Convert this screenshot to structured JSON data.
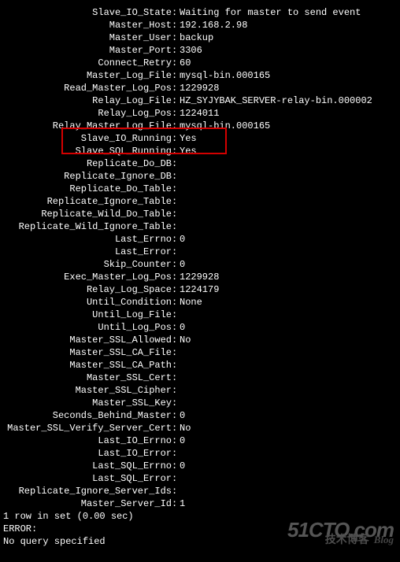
{
  "status": {
    "rows": [
      {
        "label": "Slave_IO_State",
        "value": "Waiting for master to send event"
      },
      {
        "label": "Master_Host",
        "value": "192.168.2.98"
      },
      {
        "label": "Master_User",
        "value": "backup"
      },
      {
        "label": "Master_Port",
        "value": "3306"
      },
      {
        "label": "Connect_Retry",
        "value": "60"
      },
      {
        "label": "Master_Log_File",
        "value": "mysql-bin.000165"
      },
      {
        "label": "Read_Master_Log_Pos",
        "value": "1229928"
      },
      {
        "label": "Relay_Log_File",
        "value": "HZ_SYJYBAK_SERVER-relay-bin.000002"
      },
      {
        "label": "Relay_Log_Pos",
        "value": "1224011"
      },
      {
        "label": "Relay_Master_Log_File",
        "value": "mysql-bin.000165"
      },
      {
        "label": "Slave_IO_Running",
        "value": "Yes"
      },
      {
        "label": "Slave_SQL_Running",
        "value": "Yes"
      },
      {
        "label": "Replicate_Do_DB",
        "value": ""
      },
      {
        "label": "Replicate_Ignore_DB",
        "value": ""
      },
      {
        "label": "Replicate_Do_Table",
        "value": ""
      },
      {
        "label": "Replicate_Ignore_Table",
        "value": ""
      },
      {
        "label": "Replicate_Wild_Do_Table",
        "value": ""
      },
      {
        "label": "Replicate_Wild_Ignore_Table",
        "value": ""
      },
      {
        "label": "Last_Errno",
        "value": "0"
      },
      {
        "label": "Last_Error",
        "value": ""
      },
      {
        "label": "Skip_Counter",
        "value": "0"
      },
      {
        "label": "Exec_Master_Log_Pos",
        "value": "1229928"
      },
      {
        "label": "Relay_Log_Space",
        "value": "1224179"
      },
      {
        "label": "Until_Condition",
        "value": "None"
      },
      {
        "label": "Until_Log_File",
        "value": ""
      },
      {
        "label": "Until_Log_Pos",
        "value": "0"
      },
      {
        "label": "Master_SSL_Allowed",
        "value": "No"
      },
      {
        "label": "Master_SSL_CA_File",
        "value": ""
      },
      {
        "label": "Master_SSL_CA_Path",
        "value": ""
      },
      {
        "label": "Master_SSL_Cert",
        "value": ""
      },
      {
        "label": "Master_SSL_Cipher",
        "value": ""
      },
      {
        "label": "Master_SSL_Key",
        "value": ""
      },
      {
        "label": "Seconds_Behind_Master",
        "value": "0"
      },
      {
        "label": "Master_SSL_Verify_Server_Cert",
        "value": "No"
      },
      {
        "label": "Last_IO_Errno",
        "value": "0"
      },
      {
        "label": "Last_IO_Error",
        "value": ""
      },
      {
        "label": "Last_SQL_Errno",
        "value": "0"
      },
      {
        "label": "Last_SQL_Error",
        "value": ""
      },
      {
        "label": "Replicate_Ignore_Server_Ids",
        "value": ""
      },
      {
        "label": "Master_Server_Id",
        "value": "1"
      }
    ]
  },
  "footer": {
    "rowcount": "1 row in set (0.00 sec)",
    "blank": "",
    "error_label": "ERROR:",
    "error_msg": "No query specified"
  },
  "watermark": {
    "main": "51CTO.com",
    "sub": "技术博客",
    "blog": "Blog"
  }
}
